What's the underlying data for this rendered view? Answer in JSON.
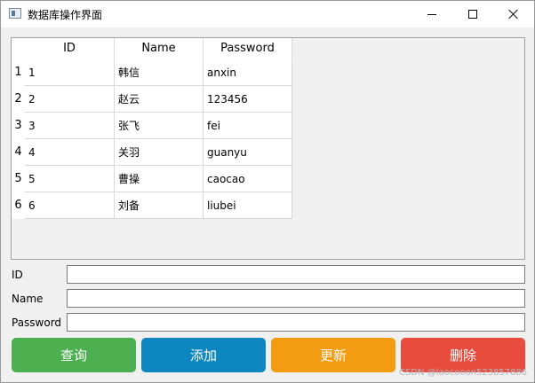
{
  "window": {
    "title": "数据库操作界面"
  },
  "table": {
    "columns": [
      "ID",
      "Name",
      "Password"
    ],
    "row_headers": [
      "1",
      "2",
      "3",
      "4",
      "5",
      "6"
    ],
    "rows": [
      [
        "1",
        "韩信",
        "anxin"
      ],
      [
        "2",
        "赵云",
        "123456"
      ],
      [
        "3",
        "张飞",
        "fei"
      ],
      [
        "4",
        "关羽",
        "guanyu"
      ],
      [
        "5",
        "曹操",
        "caocao"
      ],
      [
        "6",
        "刘备",
        "liubei"
      ]
    ]
  },
  "form": {
    "id_label": "ID",
    "id_value": "",
    "name_label": "Name",
    "name_value": "",
    "password_label": "Password",
    "password_value": ""
  },
  "buttons": {
    "query": "查询",
    "add": "添加",
    "update": "更新",
    "delete": "删除"
  },
  "colors": {
    "query": "#4caf50",
    "add": "#0e87c1",
    "update": "#f39c12",
    "delete": "#e74c3c"
  },
  "watermark": "CSDN @laocooon523857886"
}
